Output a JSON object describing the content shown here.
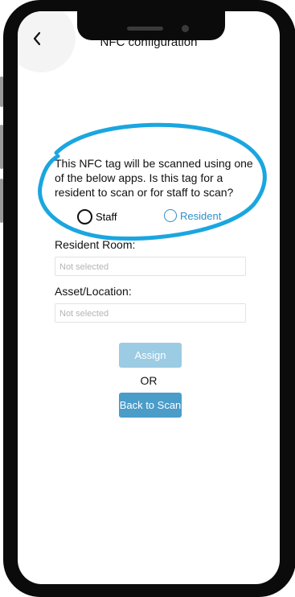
{
  "header": {
    "title": "NFC configuration",
    "back_icon": "chevron-left-icon"
  },
  "prompt": {
    "text": "This NFC tag will be scanned using one of the below apps. Is this tag for a resident to scan or for staff to scan?"
  },
  "options": [
    {
      "label": "Staff",
      "selected": false
    },
    {
      "label": "Resident",
      "selected": false,
      "color": "#2f8fc8"
    }
  ],
  "fields": {
    "resident_room": {
      "label": "Resident Room:",
      "placeholder": "Not selected"
    },
    "asset_location": {
      "label": "Asset/Location:",
      "placeholder": "Not selected"
    }
  },
  "buttons": {
    "assign": "Assign",
    "or": "OR",
    "back_to_scan": "Back to Scan"
  },
  "colors": {
    "annotation": "#1aa6e0",
    "assign_bg": "#9ccbe4",
    "back_to_scan_bg": "#4a9cc9"
  }
}
